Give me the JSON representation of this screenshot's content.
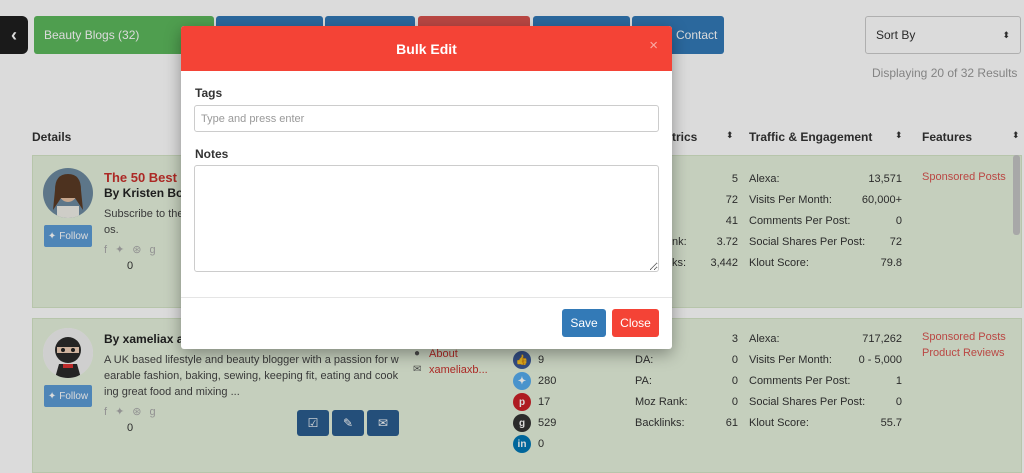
{
  "tabs": {
    "beauty_blogs": "Beauty Blogs (32)",
    "contact": "Contact"
  },
  "sort": {
    "label": "Sort By"
  },
  "results": {
    "displaying": "Displaying 20 of 32 Results"
  },
  "table": {
    "col_details": "Details",
    "col_metrics": "trics",
    "col_traffic": "Traffic & Engagement",
    "col_features": "Features"
  },
  "row1": {
    "title": "The 50 Best",
    "author": "By Kristen Bous",
    "desc_line1": "Subscribe to the",
    "desc_line2": "os.",
    "follow": "Follow",
    "followers": "0",
    "metric_values": [
      "5",
      "72",
      "41",
      "3.72",
      "3,442"
    ],
    "metric_label_fragments": [
      "nk:",
      "ks:"
    ],
    "traffic_labels": [
      "Alexa:",
      "Visits Per Month:",
      "Comments Per Post:",
      "Social Shares Per Post:",
      "Klout Score:"
    ],
    "traffic_values": [
      "13,571",
      "60,000+",
      "0",
      "72",
      "79.8"
    ],
    "features": [
      "Sponsored Posts"
    ]
  },
  "row2": {
    "author": "By xameliax at",
    "desc": "A UK based lifestyle and beauty blogger with a passion for w earable fashion, baking, sewing, keeping fit, eating and cook ing great food and mixing ...",
    "desc_line1": "A UK based lifestyle and beauty blogger with a passion for w",
    "desc_line2": "earable fashion, baking, sewing, keeping fit, eating and cook",
    "desc_line3": "ing great food and mixing ...",
    "follow": "Follow",
    "followers": "0",
    "link_about": "About",
    "link_site": "xameliaxb...",
    "social_counts": [
      "9",
      "280",
      "17",
      "529",
      "0"
    ],
    "metric_labels": [
      "DA:",
      "PA:",
      "Moz Rank:",
      "Backlinks:"
    ],
    "metric_values": [
      "3",
      "0",
      "0",
      "0",
      "61"
    ],
    "traffic_labels": [
      "Alexa:",
      "Visits Per Month:",
      "Comments Per Post:",
      "Social Shares Per Post:",
      "Klout Score:"
    ],
    "traffic_values": [
      "717,262",
      "0 - 5,000",
      "1",
      "0",
      "55.7"
    ],
    "features": [
      "Sponsored Posts",
      "Product Reviews"
    ]
  },
  "modal": {
    "title": "Bulk Edit",
    "close_icon": "×",
    "tags_label": "Tags",
    "tags_placeholder": "Type and press enter",
    "tags_value": "",
    "notes_label": "Notes",
    "notes_value": "",
    "save": "Save",
    "close": "Close"
  },
  "colors": {
    "modal_header": "#f44336",
    "save_button": "#337ab7",
    "row_background": "#e6f2dd",
    "tab_green": "#5cb85c"
  },
  "icons": [
    "chevron-left-icon",
    "twitter-icon",
    "facebook-icon",
    "pinterest-icon",
    "google-plus-icon",
    "linkedin-icon",
    "thumbs-up-icon",
    "user-icon",
    "envelope-icon",
    "edit-icon",
    "check-square-icon",
    "sort-icon"
  ]
}
